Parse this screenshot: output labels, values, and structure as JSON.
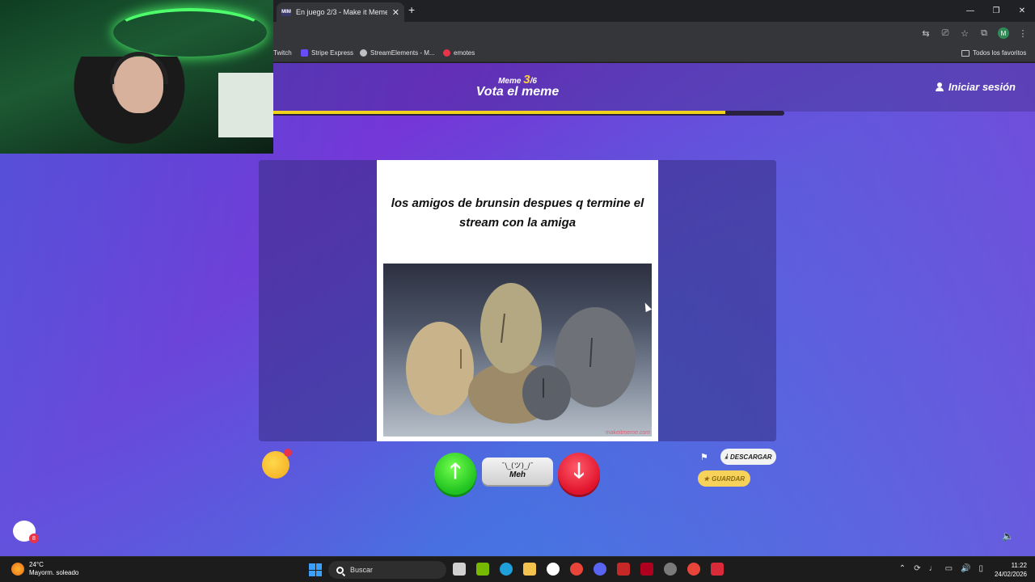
{
  "browser": {
    "tab_title": "En juego 2/3 - Make it Meme",
    "tab_favicon": "MIM",
    "new_tab_symbol": "+",
    "bookmarks": [
      {
        "label": "Twitch",
        "color": ""
      },
      {
        "label": "Stripe Express",
        "color": "#6a4cff"
      },
      {
        "label": "StreamElements - M...",
        "color": "#c0c0c0"
      },
      {
        "label": "emotes",
        "color": "#e8344a"
      }
    ],
    "all_bookmarks": "Todos los favoritos",
    "profile_initial": "M"
  },
  "game": {
    "counter_prefix": "Meme",
    "counter_current": "3",
    "counter_total": "/6",
    "heading": "Vota el meme",
    "login": "Iniciar sesión",
    "progress_fraction": 0.925,
    "meme": {
      "caption": "los amigos de brunsin despues q termine el stream con la amiga",
      "watermark": "makeitmeme.com"
    },
    "vote": {
      "up_symbol": "🡑",
      "down_symbol": "🡓",
      "meh_face": "¯\\_(ツ)_/¯",
      "meh_label": "Meh"
    },
    "download_label": "DESCARGAR",
    "save_label": "GUARDAR",
    "chat_badge": "8"
  },
  "taskbar": {
    "temperature": "24°C",
    "weather": "Mayorm. soleado",
    "search_label": "Buscar",
    "time": "11:22",
    "date": "24/02/2026"
  },
  "colors": {
    "accent_progress": "#f0d21a",
    "vote_up": "#1fc21f",
    "vote_down": "#e0132b"
  }
}
